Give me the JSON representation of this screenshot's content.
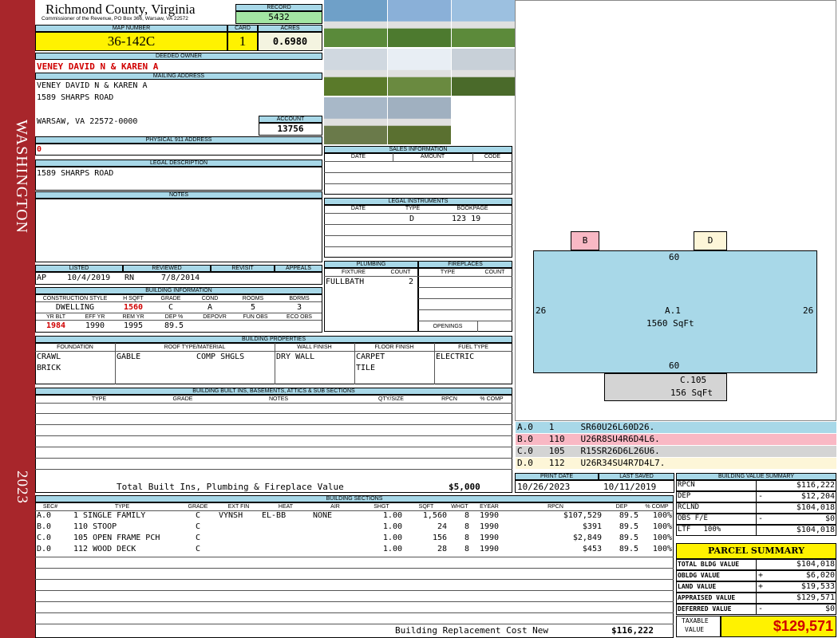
{
  "side": {
    "top": "WASHINGTON",
    "bottom": "2023"
  },
  "header": {
    "county": "Richmond County, Virginia",
    "commissioner": "Commissioner of the Revenue, PO Box 366, Warsaw, VA 22572",
    "record_label": "RECORD",
    "record": "5432",
    "map_label": "MAP NUMBER",
    "map": "36-142C",
    "card_label": "CARD",
    "card": "1",
    "acres_label": "ACRES",
    "acres": "0.6980"
  },
  "owner": {
    "label": "DEEDED OWNER",
    "name": "VENEY DAVID N & KAREN A",
    "mailing_label": "MAILING ADDRESS",
    "line1": "VENEY DAVID N & KAREN A",
    "line2": "1589 SHARPS ROAD",
    "line3": "WARSAW, VA 22572-0000",
    "account_label": "ACCOUNT",
    "account": "13756",
    "p911_label": "PHYSICAL 911 ADDRESS",
    "p911": "0",
    "legal_label": "LEGAL DESCRIPTION",
    "legal": "1589 SHARPS ROAD",
    "notes_label": "NOTES"
  },
  "listing": {
    "listed_label": "LISTED",
    "reviewed_label": "REVIEWED",
    "revisit_label": "REVISIT",
    "appeals_label": "APPEALS",
    "listed_by": "AP",
    "listed_date": "10/4/2019",
    "reviewed_by": "RN",
    "reviewed_date": "7/8/2014"
  },
  "building_info": {
    "label": "BUILDING INFORMATION",
    "h": [
      "CONSTRUCTION STYLE",
      "H SQFT",
      "GRADE",
      "COND",
      "ROOMS",
      "BDRMS"
    ],
    "v": [
      "DWELLING",
      "1560",
      "C",
      "A",
      "5",
      "3"
    ],
    "h2": [
      "YR BLT",
      "EFF YR",
      "REM YR",
      "DEP %",
      "DEPOVR",
      "FUN OBS",
      "ECO OBS"
    ],
    "v2": [
      "1984",
      "1990",
      "1995",
      "89.5",
      "",
      "",
      ""
    ]
  },
  "sales": {
    "label": "SALES INFORMATION",
    "h": [
      "DATE",
      "AMOUNT",
      "CODE"
    ]
  },
  "legal_instr": {
    "label": "LEGAL INSTRUMENTS",
    "h": [
      "DATE",
      "TYPE",
      "BOOKPAGE"
    ],
    "type": "D",
    "book": "123 19"
  },
  "plumbing": {
    "label": "PLUMBING",
    "h": [
      "FIXTURE",
      "COUNT"
    ],
    "fixture": "FULLBATH",
    "count": "2",
    "fire_label": "FIREPLACES",
    "fire_h": [
      "TYPE",
      "COUNT"
    ],
    "openings": "OPENINGS"
  },
  "props": {
    "label": "BUILDING PROPERTIES",
    "h": [
      "FOUNDATION",
      "ROOF TYPE/MATERIAL",
      "WALL FINISH",
      "FLOOR FINISH",
      "FUEL TYPE"
    ],
    "found1": "CRAWL",
    "found2": "BRICK",
    "roof1": "GABLE",
    "roof2": "COMP SHGLS",
    "wall": "DRY WALL",
    "floor1": "CARPET",
    "floor2": "TILE",
    "fuel": "ELECTRIC"
  },
  "builtins": {
    "label": "BUILDING BUILT INS, BASEMENTS, ATTICS & SUB SECTIONS",
    "h": [
      "TYPE",
      "GRADE",
      "NOTES",
      "QTY/SIZE",
      "RPCN",
      "% COMP"
    ],
    "total_label": "Total Built Ins, Plumbing & Fireplace Value",
    "total": "$5,000"
  },
  "dates": {
    "print_label": "PRINT DATE",
    "print": "10/26/2023",
    "saved_label": "LAST SAVED",
    "saved": "10/11/2019"
  },
  "sketch": {
    "b": "B",
    "d": "D",
    "top": "60",
    "bottom": "60",
    "left": "26",
    "right": "26",
    "a_label": "A.1",
    "a_sqft": "1560 SqFt",
    "c_label": "C.105",
    "c_sqft": "156 SqFt"
  },
  "sketch_rows": [
    {
      "t": "A.0   1     SR60U26L60D26.",
      "c": "#a8d8e8"
    },
    {
      "t": "B.0   110   U26R8SU4R6D4L6.",
      "c": "#f9b8c4"
    },
    {
      "t": "C.0   105   R15SR26D6L26U6.",
      "c": "#d4d4d4"
    },
    {
      "t": "D.0   112   U26R34SU4R7D4L7.",
      "c": "#fdf6d8"
    }
  ],
  "sections": {
    "label": "BUILDING SECTIONS",
    "h": [
      "SEC#",
      "TYPE",
      "GRADE",
      "EXT FIN",
      "HEAT",
      "AIR",
      "SHGT",
      "SQFT",
      "WHGT",
      "EYEAR",
      "RPCN",
      "DEP",
      "% COMP"
    ],
    "rows": [
      [
        "A.0",
        "1 SINGLE FAMILY",
        "C",
        "VYNSH",
        "EL-BB",
        "NONE",
        "1.00",
        "1,560",
        "8",
        "1990",
        "$107,529",
        "89.5",
        "100%"
      ],
      [
        "B.0",
        "110 STOOP",
        "C",
        "",
        "",
        "",
        "1.00",
        "24",
        "8",
        "1990",
        "$391",
        "89.5",
        "100%"
      ],
      [
        "C.0",
        "105 OPEN FRAME PCH",
        "C",
        "",
        "",
        "",
        "1.00",
        "156",
        "8",
        "1990",
        "$2,849",
        "89.5",
        "100%"
      ],
      [
        "D.0",
        "112 WOOD DECK",
        "C",
        "",
        "",
        "",
        "1.00",
        "28",
        "8",
        "1990",
        "$453",
        "89.5",
        "100%"
      ]
    ],
    "rcn_label": "Building Replacement Cost New",
    "rcn": "$116,222"
  },
  "bvs": {
    "label": "BUILDING VALUE SUMMARY",
    "rows": [
      [
        "RPCN",
        "",
        "$116,222"
      ],
      [
        "DEP",
        "-",
        "$12,204"
      ],
      [
        "RCLND",
        "",
        "$104,018"
      ],
      [
        "OBS F/E",
        "-",
        "$0"
      ],
      [
        "LTF   100%",
        "",
        "$104,018"
      ]
    ]
  },
  "parcel": {
    "label": "PARCEL SUMMARY",
    "rows": [
      [
        "TOTAL BLDG VALUE",
        "",
        "$104,018"
      ],
      [
        "OBLDG VALUE",
        "+",
        "$6,020"
      ],
      [
        "LAND VALUE",
        "+",
        "$19,533"
      ],
      [
        "APPRAISED VALUE",
        "",
        "$129,571"
      ],
      [
        "DEFERRED VALUE",
        "-",
        "$0"
      ]
    ],
    "taxable_label1": "TAXABLE",
    "taxable_label2": "VALUE",
    "taxable": "$129,571"
  }
}
